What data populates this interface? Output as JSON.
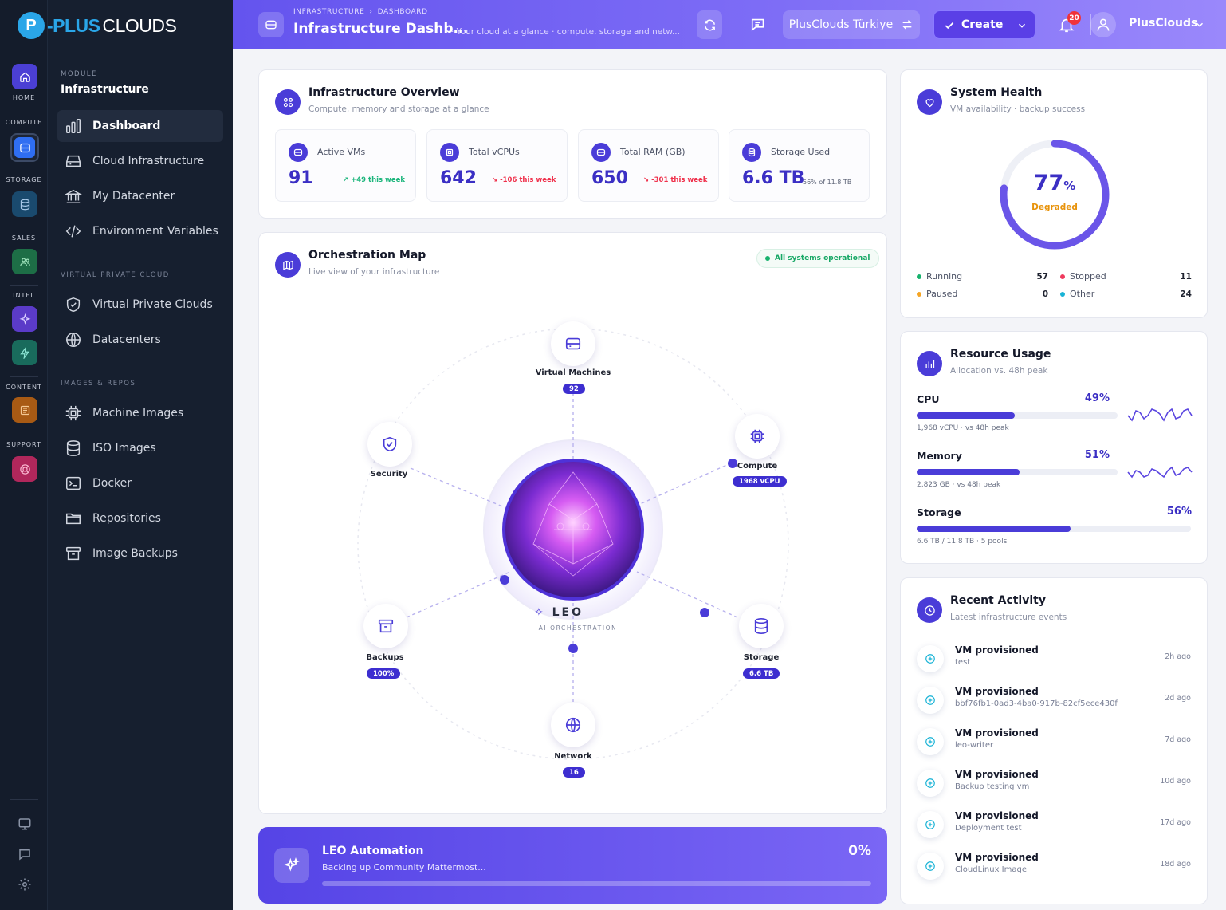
{
  "brand": {
    "logo_glyph": "P",
    "logo_plus": "-PLUS",
    "logo_clouds": "CLOUDS"
  },
  "rail": {
    "sections": [
      {
        "key": "home",
        "label": "HOME"
      },
      {
        "key": "compute",
        "label": "COMPUTE"
      },
      {
        "key": "storage",
        "label": "STORAGE"
      },
      {
        "key": "sales",
        "label": "SALES"
      },
      {
        "key": "intel",
        "label": "INTEL"
      },
      {
        "key": "content",
        "label": "CONTENT"
      },
      {
        "key": "support",
        "label": "SUPPORT"
      }
    ]
  },
  "sidebar": {
    "module_label": "MODULE",
    "module_title": "Infrastructure",
    "items": [
      {
        "label": "Dashboard",
        "icon": "bar-chart-icon",
        "active": true
      },
      {
        "label": "Cloud Infrastructure",
        "icon": "server-icon"
      },
      {
        "label": "My Datacenter",
        "icon": "bank-icon"
      },
      {
        "label": "Environment Variables",
        "icon": "code-icon"
      }
    ],
    "group_vpc": "VIRTUAL PRIVATE CLOUD",
    "vpc_items": [
      {
        "label": "Virtual Private Clouds",
        "icon": "shield-icon"
      },
      {
        "label": "Datacenters",
        "icon": "globe-icon"
      }
    ],
    "group_images": "IMAGES & REPOS",
    "image_items": [
      {
        "label": "Machine Images",
        "icon": "chip-icon"
      },
      {
        "label": "ISO Images",
        "icon": "database-icon"
      },
      {
        "label": "Docker",
        "icon": "terminal-icon"
      },
      {
        "label": "Repositories",
        "icon": "folder-icon"
      },
      {
        "label": "Image Backups",
        "icon": "archive-icon"
      }
    ]
  },
  "topbar": {
    "breadcrumb": [
      "INFRASTRUCTURE",
      "DASHBOARD"
    ],
    "title": "Infrastructure Dashb...",
    "subtitle": "· Your cloud at a glance · compute, storage and netw...",
    "tenant": "PlusClouds Türkiye",
    "create_label": "Create",
    "notifications": "20",
    "user": "PlusClouds"
  },
  "overview": {
    "title": "Infrastructure Overview",
    "subtitle": "Compute, memory and storage at a glance",
    "stats": [
      {
        "label": "Active VMs",
        "value": "91",
        "delta": "+49 this week",
        "trend": "up"
      },
      {
        "label": "Total vCPUs",
        "value": "642",
        "delta": "-106 this week",
        "trend": "down"
      },
      {
        "label": "Total RAM (GB)",
        "value": "650",
        "delta": "-301 this week",
        "trend": "down"
      },
      {
        "label": "Storage Used",
        "value": "6.6 TB",
        "delta": "56% of 11.8 TB",
        "trend": "neutral"
      }
    ]
  },
  "orchestration": {
    "title": "Orchestration Map",
    "subtitle": "Live view of your infrastructure",
    "status": "All systems operational",
    "center_title": "LEO",
    "center_sub": "AI ORCHESTRATION",
    "nodes": [
      {
        "key": "vm",
        "label": "Virtual Machines",
        "badge": "92"
      },
      {
        "key": "compute",
        "label": "Compute",
        "badge": "1968 vCPU"
      },
      {
        "key": "storage",
        "label": "Storage",
        "badge": "6.6 TB"
      },
      {
        "key": "network",
        "label": "Network",
        "badge": "16"
      },
      {
        "key": "backups",
        "label": "Backups",
        "badge": "100%"
      },
      {
        "key": "security",
        "label": "Security",
        "badge": ""
      }
    ]
  },
  "automation": {
    "title": "LEO Automation",
    "subtitle": "Backing up Community Mattermost...",
    "percent_label": "0%",
    "progress": 0
  },
  "health": {
    "title": "System Health",
    "subtitle": "VM availability · backup success",
    "percent_value": "77",
    "percent_sign": "%",
    "progress": 77,
    "status": "Degraded",
    "legend": [
      {
        "label": "Running",
        "value": "57",
        "color": "#17b26d"
      },
      {
        "label": "Stopped",
        "value": "11",
        "color": "#ef3a5d"
      },
      {
        "label": "Paused",
        "value": "0",
        "color": "#f5a524"
      },
      {
        "label": "Other",
        "value": "24",
        "color": "#19b3d6"
      }
    ]
  },
  "resources": {
    "title": "Resource Usage",
    "subtitle": "Allocation vs. 48h peak",
    "items": [
      {
        "label": "CPU",
        "percent": "49%",
        "value": 49,
        "caption": "1,968 vCPU · vs 48h peak",
        "spark": [
          0.5,
          0.2,
          0.8,
          0.7,
          0.3,
          0.5,
          0.9,
          0.8,
          0.6,
          0.2,
          0.7,
          0.9,
          0.3,
          0.4,
          0.8,
          0.9,
          0.5
        ]
      },
      {
        "label": "Memory",
        "percent": "51%",
        "value": 51,
        "caption": "2,823 GB · vs 48h peak",
        "spark": [
          0.6,
          0.3,
          0.7,
          0.6,
          0.3,
          0.4,
          0.8,
          0.7,
          0.5,
          0.3,
          0.7,
          0.9,
          0.4,
          0.5,
          0.8,
          0.9,
          0.6
        ]
      },
      {
        "label": "Storage",
        "percent": "56%",
        "value": 56,
        "caption": "6.6 TB / 11.8 TB · 5 pools"
      }
    ]
  },
  "activity": {
    "title": "Recent Activity",
    "subtitle": "Latest infrastructure events",
    "items": [
      {
        "title": "VM provisioned",
        "sub": "test",
        "time": "2h ago"
      },
      {
        "title": "VM provisioned",
        "sub": "bbf76fb1-0ad3-4ba0-917b-82cf5ece430f",
        "time": "2d ago"
      },
      {
        "title": "VM provisioned",
        "sub": "leo-writer",
        "time": "7d ago"
      },
      {
        "title": "VM provisioned",
        "sub": "Backup testing vm",
        "time": "10d ago"
      },
      {
        "title": "VM provisioned",
        "sub": "Deployment test",
        "time": "17d ago"
      },
      {
        "title": "VM provisioned",
        "sub": "CloudLinux Image",
        "time": "18d ago"
      }
    ]
  },
  "colors": {
    "accent": "#4a3cd8",
    "topbar": "#6454ee",
    "sidebar": "#161f2f",
    "rail": "#141c2b"
  }
}
